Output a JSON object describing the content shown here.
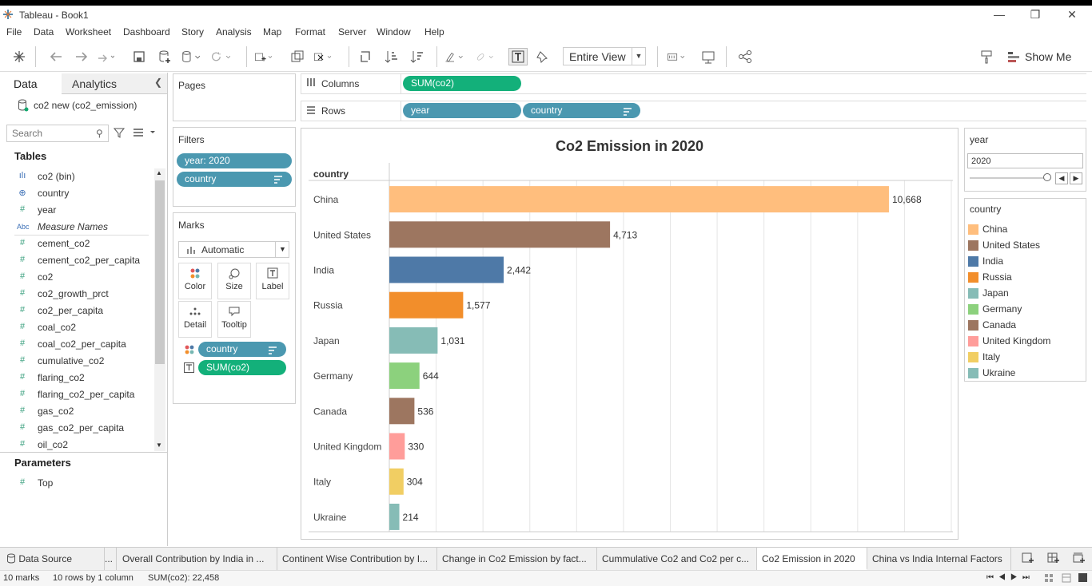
{
  "window": {
    "title": "Tableau - Book1",
    "minimize": "—",
    "restore": "❐",
    "close": "✕"
  },
  "menu": [
    "File",
    "Data",
    "Worksheet",
    "Dashboard",
    "Story",
    "Analysis",
    "Map",
    "Format",
    "Server",
    "Window",
    "Help"
  ],
  "toolbar": {
    "fit": "Entire View",
    "show_me": "Show Me"
  },
  "data_pane": {
    "tabs": [
      "Data",
      "Analytics"
    ],
    "datasource": "co2 new (co2_emission)",
    "search_placeholder": "Search",
    "tables_header": "Tables",
    "fields": [
      {
        "icon": "ılı",
        "name": "co2 (bin)"
      },
      {
        "icon": "⊕",
        "name": "country"
      },
      {
        "icon": "#",
        "name": "year"
      },
      {
        "icon": "Abc",
        "name": "Measure Names"
      },
      {
        "icon": "#",
        "name": "cement_co2"
      },
      {
        "icon": "#",
        "name": "cement_co2_per_capita"
      },
      {
        "icon": "#",
        "name": "co2"
      },
      {
        "icon": "#",
        "name": "co2_growth_prct"
      },
      {
        "icon": "#",
        "name": "co2_per_capita"
      },
      {
        "icon": "#",
        "name": "coal_co2"
      },
      {
        "icon": "#",
        "name": "coal_co2_per_capita"
      },
      {
        "icon": "#",
        "name": "cumulative_co2"
      },
      {
        "icon": "#",
        "name": "flaring_co2"
      },
      {
        "icon": "#",
        "name": "flaring_co2_per_capita"
      },
      {
        "icon": "#",
        "name": "gas_co2"
      },
      {
        "icon": "#",
        "name": "gas_co2_per_capita"
      },
      {
        "icon": "#",
        "name": "oil_co2"
      }
    ],
    "parameters_header": "Parameters",
    "parameters": [
      {
        "icon": "#",
        "name": "Top"
      }
    ]
  },
  "pages": {
    "title": "Pages"
  },
  "filters": {
    "title": "Filters",
    "items": [
      "year: 2020",
      "country"
    ]
  },
  "marks": {
    "title": "Marks",
    "type": "Automatic",
    "buttons": [
      "Color",
      "Size",
      "Label",
      "Detail",
      "Tooltip"
    ],
    "fields": [
      "country",
      "SUM(co2)"
    ]
  },
  "shelves": {
    "columns_label": "Columns",
    "rows_label": "Rows",
    "columns": [
      "SUM(co2)"
    ],
    "rows": [
      "year",
      "country"
    ]
  },
  "colors": {
    "China": "#ffbe7d",
    "United States": "#9d7660",
    "India": "#4e79a7",
    "Russia": "#f28e2b",
    "Japan": "#86bcb6",
    "Germany": "#8cd17d",
    "Canada": "#9d7660",
    "United Kingdom": "#ff9d9a",
    "Italy": "#f1ce63",
    "Ukraine": "#86bcb6"
  },
  "chart_data": {
    "type": "bar",
    "title": "Co2 Emission in 2020",
    "row_header": "country",
    "categories": [
      "China",
      "United States",
      "India",
      "Russia",
      "Japan",
      "Germany",
      "Canada",
      "United Kingdom",
      "Italy",
      "Ukraine"
    ],
    "values": [
      10668,
      4713,
      2442,
      1577,
      1031,
      644,
      536,
      330,
      304,
      214
    ],
    "labels": [
      "10,668",
      "4,713",
      "2,442",
      "1,577",
      "1,031",
      "644",
      "536",
      "330",
      "304",
      "214"
    ],
    "xlim": [
      0,
      12000
    ],
    "grid": true,
    "orientation": "horizontal"
  },
  "year_filter": {
    "title": "year",
    "value": "2020"
  },
  "legend": {
    "title": "country",
    "items": [
      "China",
      "United States",
      "India",
      "Russia",
      "Japan",
      "Germany",
      "Canada",
      "United Kingdom",
      "Italy",
      "Ukraine"
    ]
  },
  "sheet_tabs": [
    "Data Source",
    "...",
    "Overall Contribution by India in ...",
    "Continent Wise Contribution by I...",
    "Change in Co2 Emission by fact...",
    "Cummulative Co2 and Co2 per c...",
    "Co2 Emission in 2020",
    "China vs India Internal Factors"
  ],
  "active_tab": "Co2 Emission in 2020",
  "status": {
    "marks": "10 marks",
    "rows": "10 rows by 1 column",
    "sum": "SUM(co2): 22,458"
  }
}
